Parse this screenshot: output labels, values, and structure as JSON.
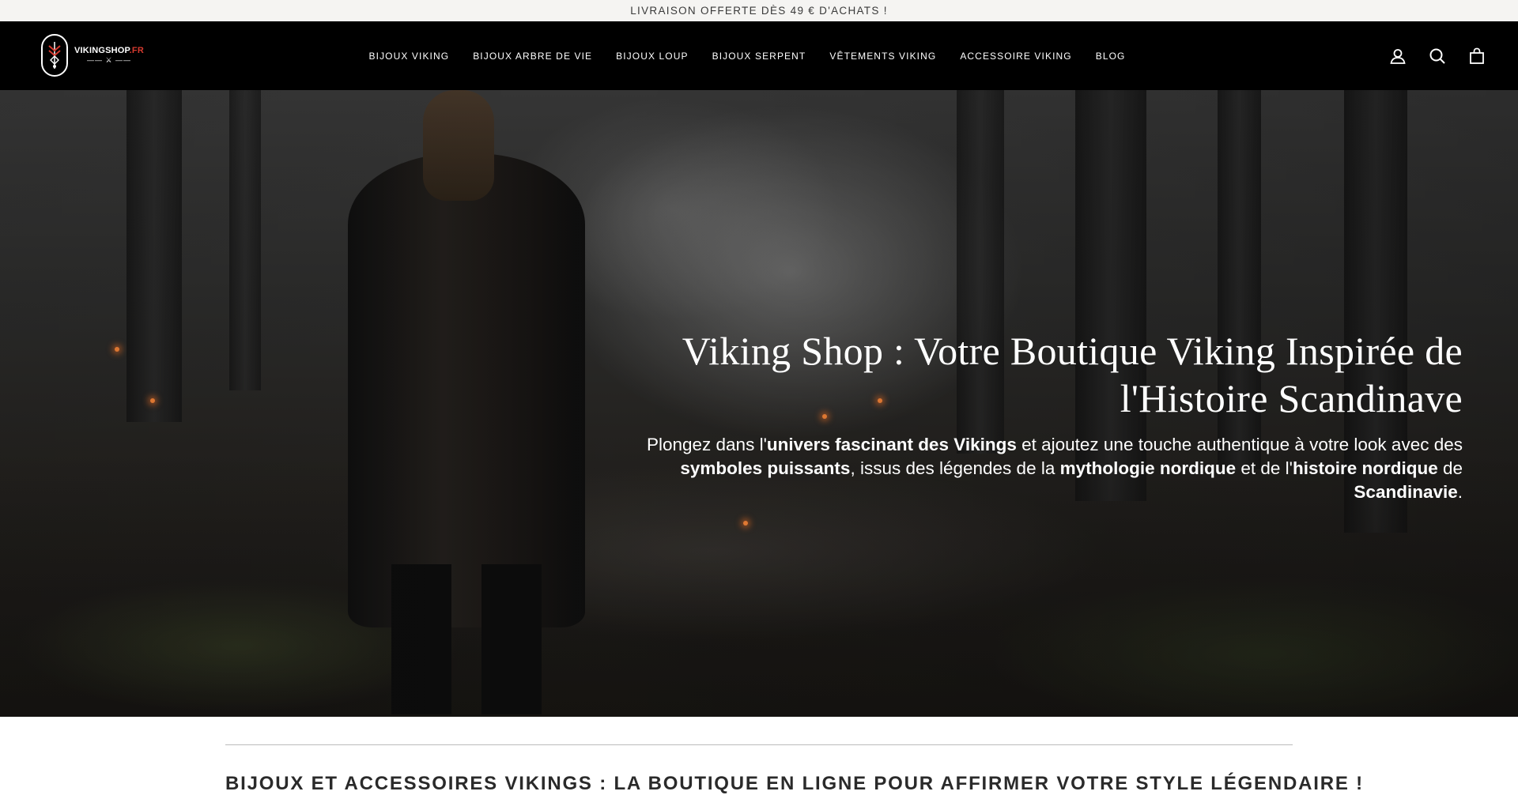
{
  "announcement": {
    "text": "LIVRAISON OFFERTE DÈS 49 € D'ACHATS !"
  },
  "logo": {
    "name": "VIKINGSHOP",
    "tld": ".FR",
    "ornament": "—— ⚔ ——"
  },
  "nav": {
    "items": [
      {
        "label": "BIJOUX VIKING"
      },
      {
        "label": "BIJOUX ARBRE DE VIE"
      },
      {
        "label": "BIJOUX LOUP"
      },
      {
        "label": "BIJOUX SERPENT"
      },
      {
        "label": "VÊTEMENTS VIKING"
      },
      {
        "label": "ACCESSOIRE VIKING"
      },
      {
        "label": "BLOG"
      }
    ]
  },
  "header_icons": [
    "account-icon",
    "search-icon",
    "cart-icon"
  ],
  "hero": {
    "title_line1": "Viking Shop : Votre Boutique Viking Inspirée de",
    "title_line2": "l'Histoire Scandinave",
    "sub": {
      "p1": "Plongez dans l'",
      "b1": "univers fascinant des Vikings",
      "p2": " et ajoutez une touche authentique à votre look avec des ",
      "b2": "symboles puissants",
      "p3": ", issus des légendes de la ",
      "b3": "mythologie nordique",
      "p4": " et de l'",
      "b4": "histoire nordique",
      "p5": " de ",
      "b5": "Scandinavie",
      "p6": "."
    }
  },
  "section": {
    "heading": "BIJOUX ET ACCESSOIRES VIKINGS : LA BOUTIQUE EN LIGNE POUR AFFIRMER VOTRE STYLE LÉGENDAIRE !"
  },
  "colors": {
    "header_bg": "#000000",
    "announce_bg": "#f5f4f2",
    "logo_tld": "#d63a2f",
    "hero_text": "#ffffff"
  }
}
